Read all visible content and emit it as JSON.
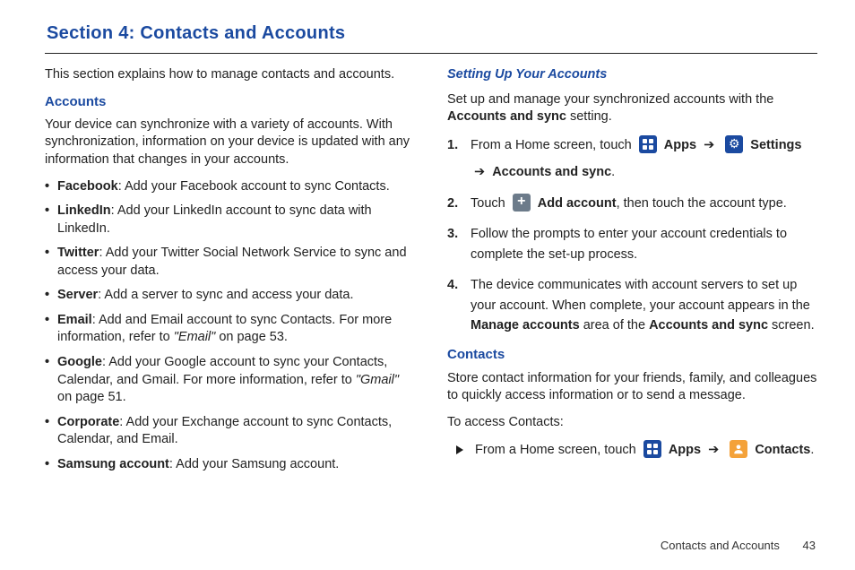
{
  "title": "Section 4: Contacts and Accounts",
  "intro": "This section explains how to manage contacts and accounts.",
  "accounts": {
    "heading": "Accounts",
    "lead": "Your device can synchronize with a variety of accounts. With synchronization, information on your device is updated with any information that changes in your accounts.",
    "items": [
      {
        "name": "Facebook",
        "desc": ": Add your Facebook account to sync Contacts."
      },
      {
        "name": "LinkedIn",
        "desc": ": Add your LinkedIn account to sync data with LinkedIn."
      },
      {
        "name": "Twitter",
        "desc": ": Add your Twitter Social Network Service to sync and access your data."
      },
      {
        "name": "Server",
        "desc": ": Add a server to sync and access your data."
      },
      {
        "name": "Email",
        "desc": ": Add and Email account to sync Contacts. For more information, refer to ",
        "ref": "\"Email\"",
        "page": "  on page 53."
      },
      {
        "name": "Google",
        "desc": ": Add your Google account to sync your Contacts, Calendar, and Gmail. For more information, refer to ",
        "ref": "\"Gmail\"",
        "page": "  on page 51."
      },
      {
        "name": "Corporate",
        "desc": ": Add your Exchange account to sync Contacts, Calendar, and Email."
      },
      {
        "name": "Samsung account",
        "desc": ": Add your Samsung account."
      }
    ]
  },
  "setup": {
    "heading": "Setting Up Your Accounts",
    "lead1": "Set up and manage your synchronized accounts with the ",
    "lead_bold": "Accounts and sync",
    "lead2": " setting.",
    "step1_a": "From a Home screen, touch ",
    "apps_label": "Apps",
    "arrow": "➔",
    "settings_label": "Settings",
    "accounts_sync": "Accounts and sync",
    "step2_a": "Touch ",
    "add_account": "Add account",
    "step2_b": ", then touch the account type.",
    "step3": "Follow the prompts to enter your account credentials to complete the set-up process.",
    "step4_a": "The device communicates with account servers to set up your account. When complete, your account appears in the ",
    "manage_accounts": "Manage accounts",
    "step4_b": " area of the ",
    "step4_c": " screen."
  },
  "contacts": {
    "heading": "Contacts",
    "lead": "Store contact information for your friends, family, and colleagues to quickly access information or to send a message.",
    "access": "To access Contacts:",
    "bullet_a": "From a Home screen, touch ",
    "contacts_label": "Contacts"
  },
  "footer": {
    "text": "Contacts and Accounts",
    "page": "43"
  },
  "chart_data": null
}
